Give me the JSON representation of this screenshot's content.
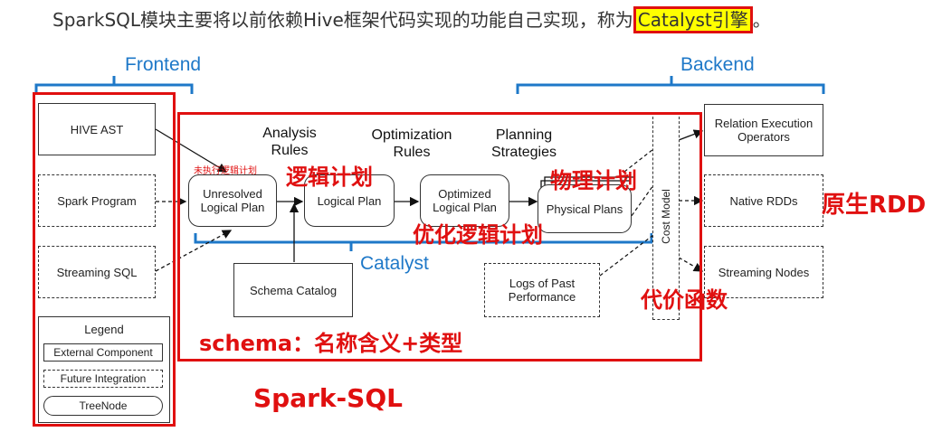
{
  "heading": {
    "prefix": "SparkSQL模块主要将以前依赖Hive框架代码实现的功能自己实现，称为",
    "highlight": "Catalyst引擎",
    "suffix": "。"
  },
  "braces": {
    "frontend": "Frontend",
    "backend": "Backend",
    "catalyst": "Catalyst"
  },
  "frontend_boxes": {
    "hive_ast": "HIVE AST",
    "spark_program": "Spark Program",
    "streaming_sql": "Streaming SQL"
  },
  "legend": {
    "title": "Legend",
    "external": "External Component",
    "future": "Future Integration",
    "treenode": "TreeNode"
  },
  "stages": {
    "analysis": "Analysis\nRules",
    "optimization": "Optimization\nRules",
    "planning": "Planning\nStrategies"
  },
  "nodes": {
    "unresolved": "Unresolved\nLogical Plan",
    "logical": "Logical Plan",
    "optimized": "Optimized\nLogical Plan",
    "physical": "Physical Plans",
    "schema_catalog": "Schema Catalog",
    "logs": "Logs of Past\nPerformance",
    "cost_model": "Cost Model"
  },
  "backend_boxes": {
    "relation": "Relation Execution\nOperators",
    "native_rdds": "Native RDDs",
    "streaming_nodes": "Streaming Nodes"
  },
  "annotations": {
    "unexecuted": "未执行逻辑计划",
    "logical_plan": "逻辑计划",
    "physical_plan": "物理计划",
    "optimized_plan": "优化逻辑计划",
    "native_rdd": "原生RDD",
    "cost_function": "代价函数",
    "schema": "schema：名称含义+类型",
    "spark_sql": "Spark-SQL"
  }
}
